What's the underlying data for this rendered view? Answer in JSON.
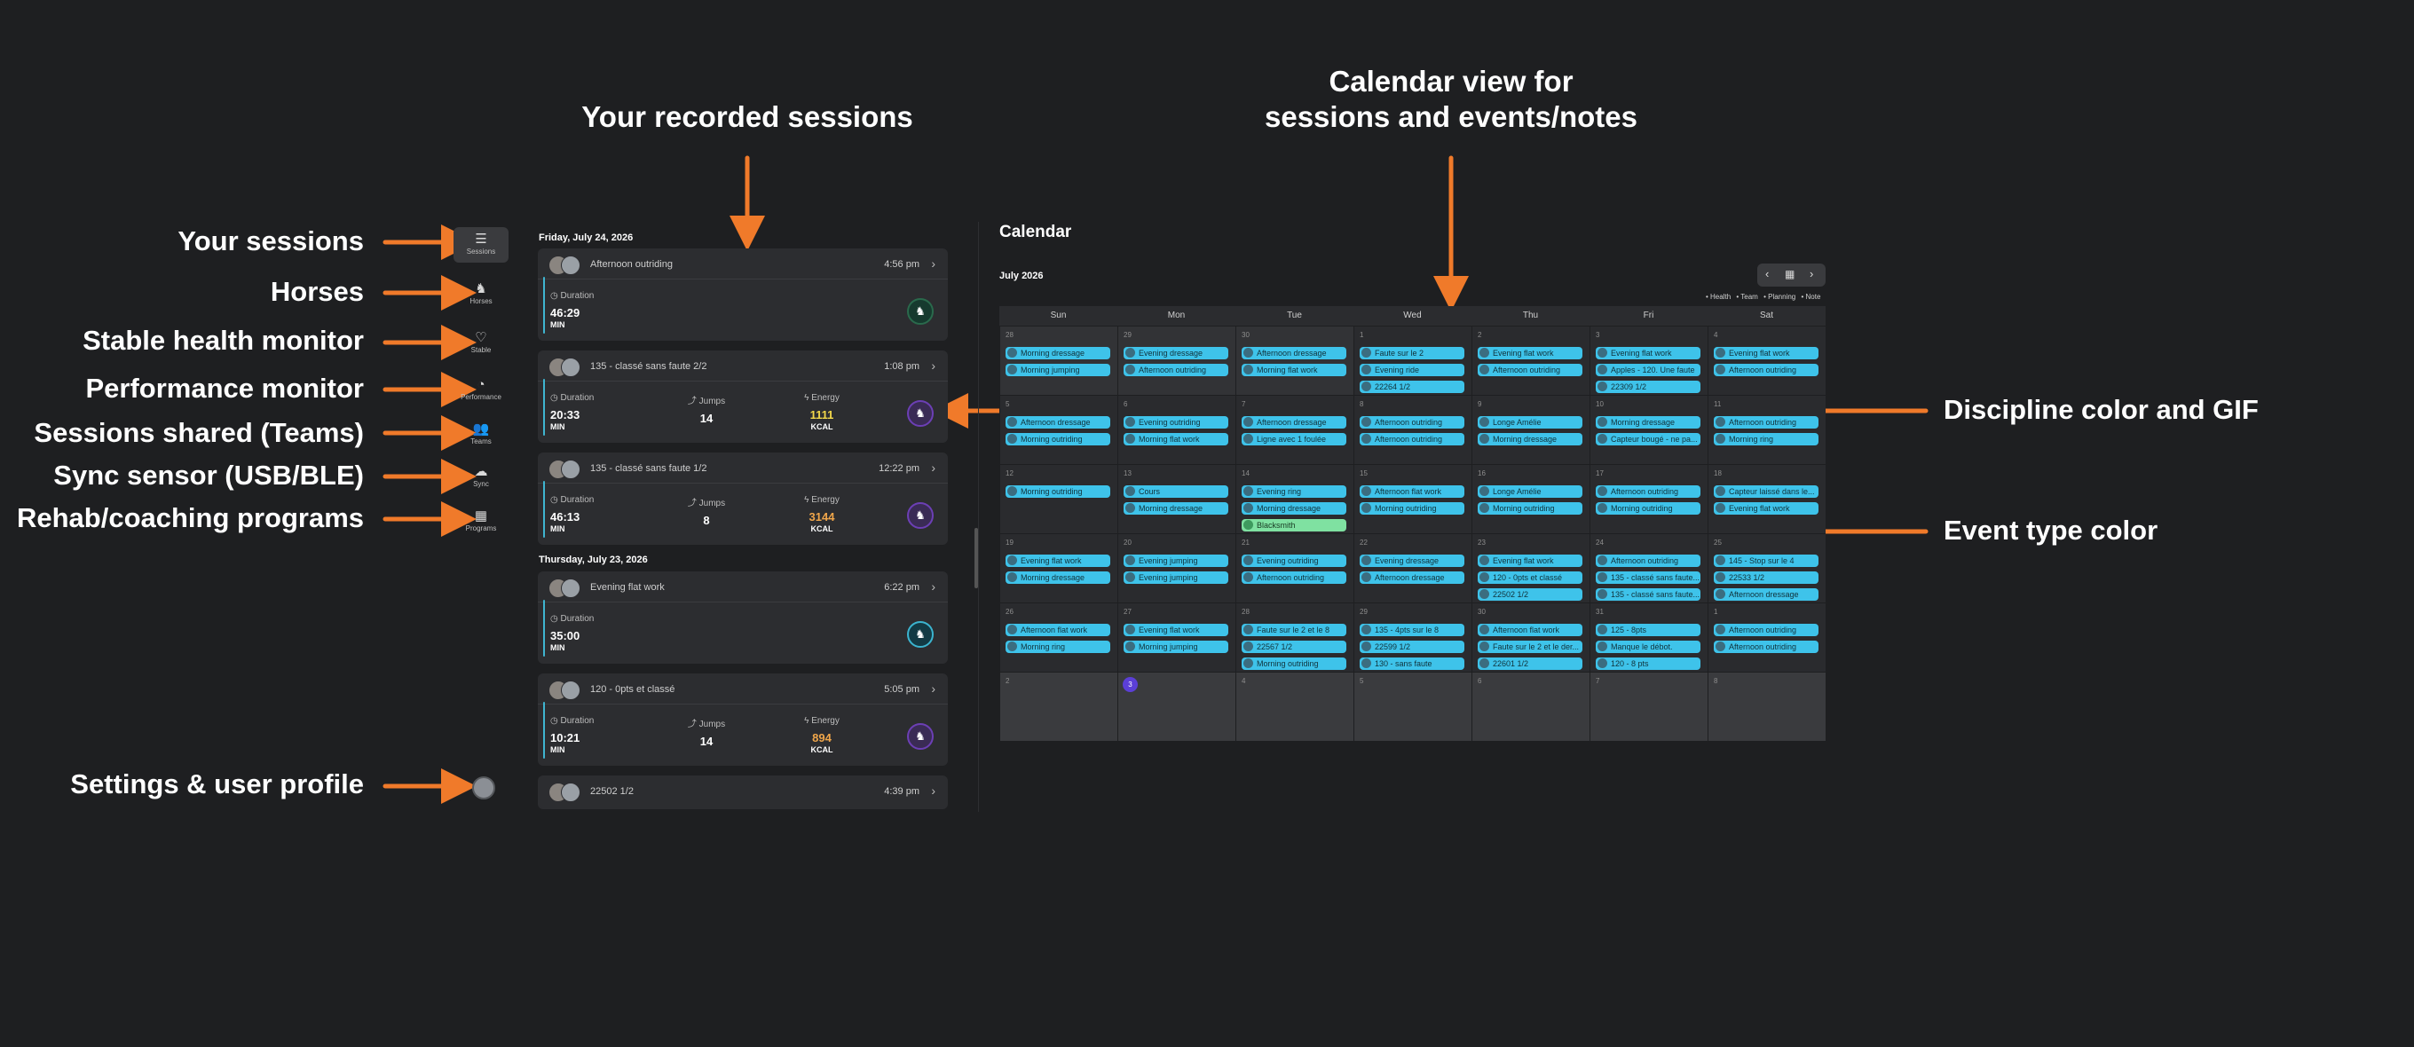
{
  "annotations": {
    "left": [
      "Your sessions",
      "Horses",
      "Stable health monitor",
      "Performance monitor",
      "Sessions shared (Teams)",
      "Sync sensor (USB/BLE)",
      "Rehab/coaching programs",
      "Settings & user profile"
    ],
    "recorded": "Your recorded sessions",
    "calendar_view_line1": "Calendar view for",
    "calendar_view_line2": "sessions and events/notes",
    "discipline": "Discipline color and GIF",
    "event_type": "Event type color"
  },
  "sidebar": {
    "items": [
      {
        "label": "Sessions",
        "icon": "list-icon",
        "active": true
      },
      {
        "label": "Horses",
        "icon": "horse-icon"
      },
      {
        "label": "Stable",
        "icon": "heart-pulse-icon"
      },
      {
        "label": "Performance",
        "icon": "gauge-icon"
      },
      {
        "label": "Teams",
        "icon": "users-icon"
      },
      {
        "label": "Sync",
        "icon": "cloud-sync-icon"
      },
      {
        "label": "Programs",
        "icon": "calendar-program-icon"
      }
    ]
  },
  "sessions": {
    "date1": "Friday, July 24, 2026",
    "date2": "Thursday, July 23, 2026",
    "labels": {
      "duration": "Duration",
      "jumps": "Jumps",
      "energy": "Energy",
      "min": "MIN",
      "kcal": "KCAL"
    },
    "cards": [
      {
        "title": "Afternoon outriding",
        "time": "4:56 pm",
        "duration": "46:29"
      },
      {
        "title": "135 - classé sans faute 2/2",
        "time": "1:08 pm",
        "duration": "20:33",
        "jumps": "14",
        "energy": "1111"
      },
      {
        "title": "135 - classé sans faute 1/2",
        "time": "12:22 pm",
        "duration": "46:13",
        "jumps": "8",
        "energy": "3144"
      },
      {
        "title": "Evening flat work",
        "time": "6:22 pm",
        "duration": "35:00"
      },
      {
        "title": "120 - 0pts et classé",
        "time": "5:05 pm",
        "duration": "10:21",
        "jumps": "14",
        "energy": "894"
      },
      {
        "title": "22502 1/2",
        "time": "4:39 pm"
      }
    ]
  },
  "calendar": {
    "title": "Calendar",
    "month": "July 2026",
    "legend": [
      "• Health",
      "• Team",
      "• Planning",
      "• Note"
    ],
    "days": [
      "Sun",
      "Mon",
      "Tue",
      "Wed",
      "Thu",
      "Fri",
      "Sat"
    ],
    "weeks": [
      [
        {
          "d": "28",
          "ev": [
            "Morning dressage",
            "Morning jumping"
          ]
        },
        {
          "d": "29",
          "ev": [
            "Evening dressage",
            "Afternoon outriding"
          ]
        },
        {
          "d": "30",
          "ev": [
            "Afternoon dressage",
            "Morning flat work"
          ]
        },
        {
          "d": "1",
          "ev": [
            "Faute sur le 2",
            "Evening ride",
            "22264 1/2"
          ]
        },
        {
          "d": "2",
          "ev": [
            "Evening flat work",
            "Afternoon outriding"
          ]
        },
        {
          "d": "3",
          "ev": [
            "Evening flat work",
            "Apples - 120. Une faute",
            "22309 1/2"
          ]
        },
        {
          "d": "4",
          "ev": [
            "Evening flat work",
            "Afternoon outriding"
          ]
        }
      ],
      [
        {
          "d": "5",
          "ev": [
            "Afternoon dressage",
            "Morning outriding"
          ]
        },
        {
          "d": "6",
          "ev": [
            "Evening outriding",
            "Morning flat work"
          ]
        },
        {
          "d": "7",
          "ev": [
            "Afternoon dressage",
            "Ligne avec 1 foulée"
          ]
        },
        {
          "d": "8",
          "ev": [
            "Afternoon outriding",
            "Afternoon outriding"
          ]
        },
        {
          "d": "9",
          "ev": [
            "Longe Amélie",
            "Morning dressage"
          ]
        },
        {
          "d": "10",
          "ev": [
            "Morning dressage",
            "Capteur bougé - ne pa..."
          ]
        },
        {
          "d": "11",
          "ev": [
            "Afternoon outriding",
            "Morning ring"
          ]
        }
      ],
      [
        {
          "d": "12",
          "ev": [
            "Morning outriding"
          ]
        },
        {
          "d": "13",
          "ev": [
            "Cours",
            "Morning dressage"
          ]
        },
        {
          "d": "14",
          "ev": [
            "Evening ring",
            "Morning dressage"
          ],
          "note": "Blacksmith"
        },
        {
          "d": "15",
          "ev": [
            "Afternoon flat work",
            "Morning outriding"
          ]
        },
        {
          "d": "16",
          "ev": [
            "Longe Amélie",
            "Morning outriding"
          ]
        },
        {
          "d": "17",
          "ev": [
            "Afternoon outriding",
            "Morning outriding"
          ]
        },
        {
          "d": "18",
          "ev": [
            "Capteur laissé dans le...",
            "Evening flat work"
          ]
        }
      ],
      [
        {
          "d": "19",
          "ev": [
            "Evening flat work",
            "Morning dressage"
          ]
        },
        {
          "d": "20",
          "ev": [
            "Evening jumping",
            "Evening jumping"
          ]
        },
        {
          "d": "21",
          "ev": [
            "Evening outriding",
            "Afternoon outriding"
          ]
        },
        {
          "d": "22",
          "ev": [
            "Evening dressage",
            "Afternoon dressage"
          ]
        },
        {
          "d": "23",
          "ev": [
            "Evening flat work",
            "120 - 0pts et classé",
            "22502 1/2"
          ]
        },
        {
          "d": "24",
          "ev": [
            "Afternoon outriding",
            "135 - classé sans faute...",
            "135 - classé sans faute..."
          ]
        },
        {
          "d": "25",
          "ev": [
            "145 - Stop sur le 4",
            "22533 1/2",
            "Afternoon dressage"
          ]
        }
      ],
      [
        {
          "d": "26",
          "ev": [
            "Afternoon flat work",
            "Morning ring"
          ]
        },
        {
          "d": "27",
          "ev": [
            "Evening flat work",
            "Morning jumping"
          ]
        },
        {
          "d": "28",
          "ev": [
            "Faute sur le 2 et le 8",
            "22567 1/2",
            "Morning outriding"
          ]
        },
        {
          "d": "29",
          "ev": [
            "135 - 4pts sur le 8",
            "22599 1/2",
            "130 - sans faute"
          ]
        },
        {
          "d": "30",
          "ev": [
            "Afternoon flat work",
            "Faute sur le 2 et le der...",
            "22601 1/2"
          ]
        },
        {
          "d": "31",
          "ev": [
            "125 - 8pts",
            "Manque le débot.",
            "120 - 8 pts"
          ]
        },
        {
          "d": "1",
          "ev": [
            "Afternoon outriding",
            "Afternoon outriding"
          ]
        }
      ],
      [
        {
          "d": "2",
          "ev": []
        },
        {
          "d": "3",
          "ev": [],
          "today": true
        },
        {
          "d": "4",
          "ev": []
        },
        {
          "d": "5",
          "ev": []
        },
        {
          "d": "6",
          "ev": []
        },
        {
          "d": "7",
          "ev": []
        },
        {
          "d": "8",
          "ev": []
        }
      ]
    ]
  },
  "colors": {
    "arrow": "#f07a2a",
    "event": "#3ec3ea",
    "note": "#7fe1a1",
    "today": "#5b3fd6",
    "energy": "#f0a64a"
  }
}
